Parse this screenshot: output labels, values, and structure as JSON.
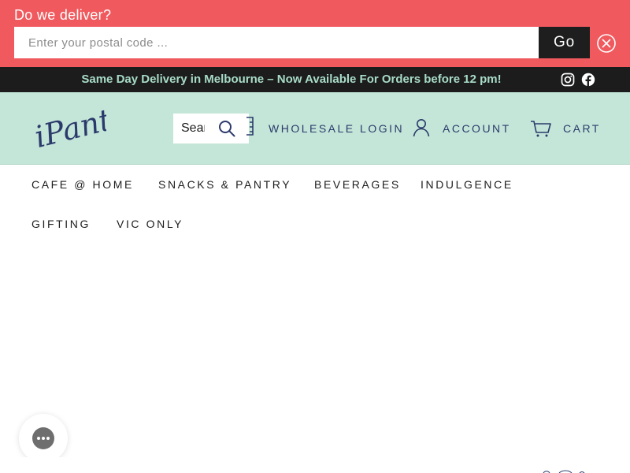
{
  "delivery_banner": {
    "title": "Do we deliver?",
    "postal_placeholder": "Enter your postal code ...",
    "go_label": "Go",
    "close_icon": "close-circle-icon"
  },
  "announcement": {
    "text": "Same Day Delivery in Melbourne – Now Available For Orders before 12 pm!",
    "social_icons": [
      "instagram-icon",
      "facebook-icon"
    ]
  },
  "header": {
    "logo_text": "iPantry",
    "search_placeholder": "Search",
    "wholesale_label": "WHOLESALE LOGIN",
    "account_label": "ACCOUNT",
    "cart_label": "CART"
  },
  "main_nav": {
    "items": [
      {
        "label": "CAFE @ HOME"
      },
      {
        "label": "SNACKS & PANTRY"
      },
      {
        "label": "BEVERAGES"
      },
      {
        "label": "INDULGENCE"
      },
      {
        "label": "GIFTING"
      },
      {
        "label": "VIC ONLY"
      }
    ]
  },
  "colors": {
    "banner_bg": "#f05a5e",
    "announce_bg": "#1c1c1c",
    "announce_text": "#a8dcc8",
    "header_bg": "#c4e6d8",
    "brand_navy": "#2b3a6b",
    "go_button_bg": "#1e1e1e"
  }
}
